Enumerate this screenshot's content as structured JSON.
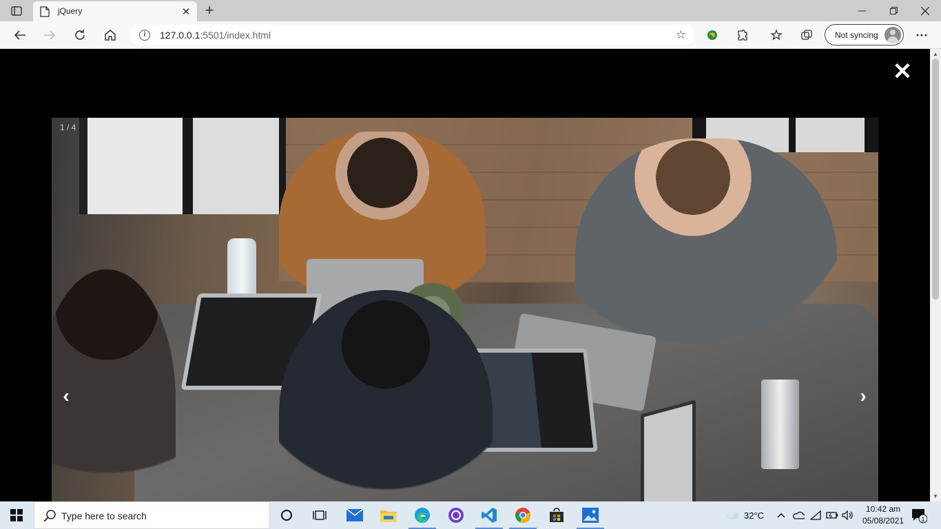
{
  "browser": {
    "tab_title": "jQuery",
    "url_host": "127.0.0.1",
    "url_rest": ":5501/index.html",
    "sync_label": "Not syncing"
  },
  "lightbox": {
    "counter": "1 / 4",
    "close_glyph": "✕",
    "prev_glyph": "‹",
    "next_glyph": "›"
  },
  "taskbar": {
    "search_placeholder": "Type here to search",
    "weather": "32°C",
    "time": "10:42 am",
    "date": "05/08/2021",
    "notification_count": "1"
  },
  "colors": {
    "overlay": "#000000",
    "taskbar": "#dfe9f2",
    "accent": "#5a8fd6"
  }
}
